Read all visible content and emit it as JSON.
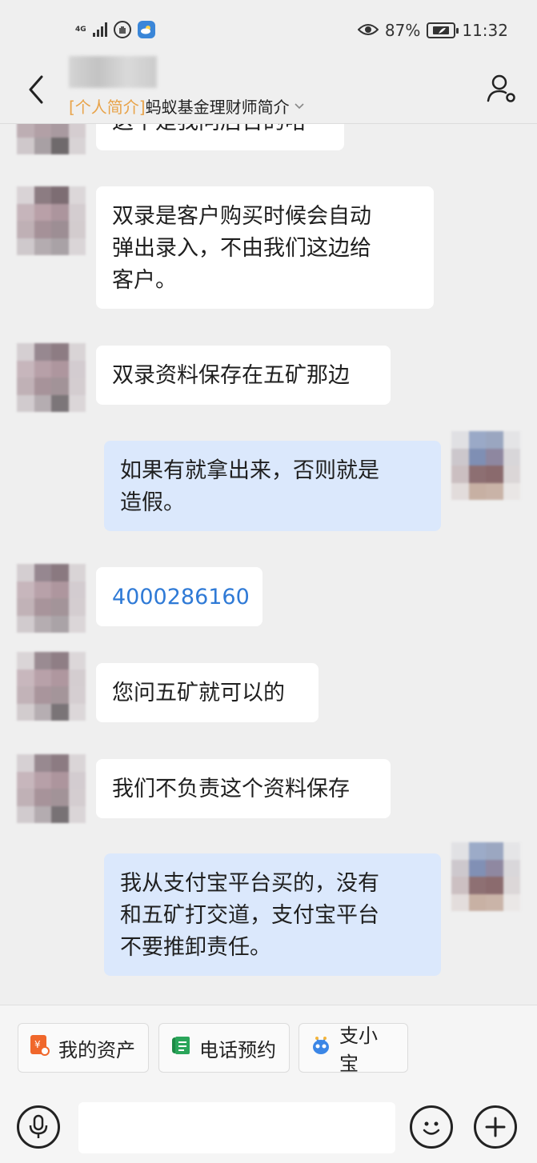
{
  "status_bar": {
    "network": "4G",
    "battery": "87%",
    "time": "11:32",
    "icons": [
      "signal-icon",
      "hand-stop-icon",
      "weather-icon",
      "eye-icon",
      "battery-icon"
    ]
  },
  "header": {
    "tag": "[个人简介]",
    "name": "蚂蚁基金理财师简介",
    "icons": [
      "back-arrow-icon",
      "chevron-down-icon",
      "contact-icon"
    ]
  },
  "messages": [
    {
      "from": "other",
      "text": "这个是我问后台的哈"
    },
    {
      "from": "other",
      "lines": [
        "双录是客户购买时候会自动",
        "弹出录入，不由我们这边给",
        "客户。"
      ]
    },
    {
      "from": "other",
      "text": "双录资料保存在五矿那边"
    },
    {
      "from": "me",
      "lines": [
        "如果有就拿出来，否则就是",
        "造假。"
      ]
    },
    {
      "from": "other",
      "text": "4000286160"
    },
    {
      "from": "other",
      "text": "您问五矿就可以的"
    },
    {
      "from": "other",
      "text": "我们不负责这个资料保存"
    },
    {
      "from": "me",
      "lines": [
        "我从支付宝平台买的，没有",
        "和五矿打交道，支付宝平台",
        "不要推卸责任。"
      ]
    }
  ],
  "quick_actions": [
    {
      "label": "我的资产",
      "icon": "asset-icon"
    },
    {
      "label": "电话预约",
      "icon": "phone-booking-icon"
    },
    {
      "label": "支小宝",
      "icon": "zhixiaobao-icon"
    }
  ],
  "input": {
    "value": "",
    "placeholder": ""
  },
  "colors": {
    "background": "#efefef",
    "bubble_other": "#ffffff",
    "bubble_mine": "#dbe8fc",
    "tag": "#e8a349",
    "link": "#2f7ad6"
  }
}
